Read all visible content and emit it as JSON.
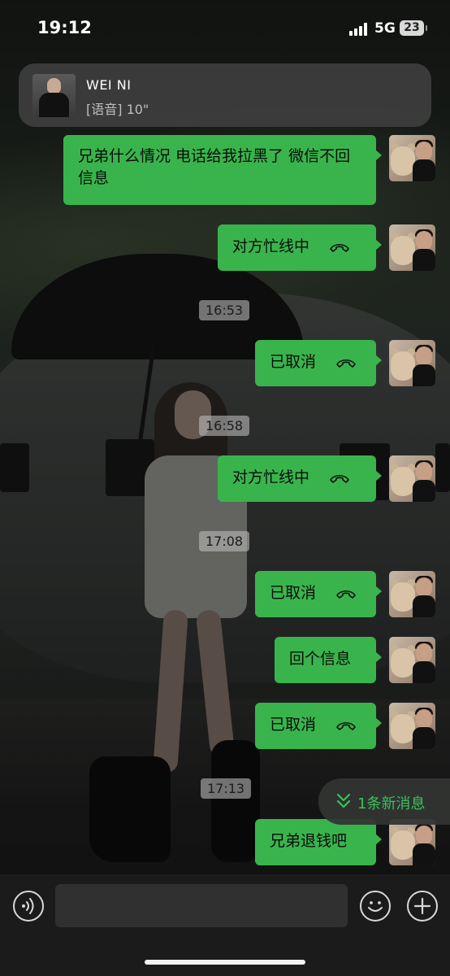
{
  "status_bar": {
    "time": "19:12",
    "network": "5G",
    "battery": "23"
  },
  "notification": {
    "name": "WEI NI",
    "preview": "[语音] 10\""
  },
  "messages": [
    {
      "kind": "text",
      "text": "兄弟什么情况 电话给我拉黑了 微信不回信息"
    },
    {
      "kind": "call",
      "text": "对方忙线中",
      "icon": "hangup-icon"
    },
    {
      "kind": "timestamp",
      "text": "16:53"
    },
    {
      "kind": "call",
      "text": "已取消",
      "icon": "hangup-icon"
    },
    {
      "kind": "timestamp",
      "text": "16:58"
    },
    {
      "kind": "call",
      "text": "对方忙线中",
      "icon": "hangup-icon"
    },
    {
      "kind": "timestamp",
      "text": "17:08"
    },
    {
      "kind": "call",
      "text": "已取消",
      "icon": "hangup-icon"
    },
    {
      "kind": "text",
      "text": "回个信息"
    },
    {
      "kind": "call",
      "text": "已取消",
      "icon": "hangup-icon"
    },
    {
      "kind": "timestamp",
      "text": "17:13"
    },
    {
      "kind": "text",
      "text": "兄弟退钱吧"
    }
  ],
  "new_messages": {
    "label": "1条新消息"
  },
  "input": {
    "placeholder": ""
  },
  "colors": {
    "bubble": "#39b44c",
    "accent": "#39c25a",
    "banner": "#3e3e3e"
  }
}
